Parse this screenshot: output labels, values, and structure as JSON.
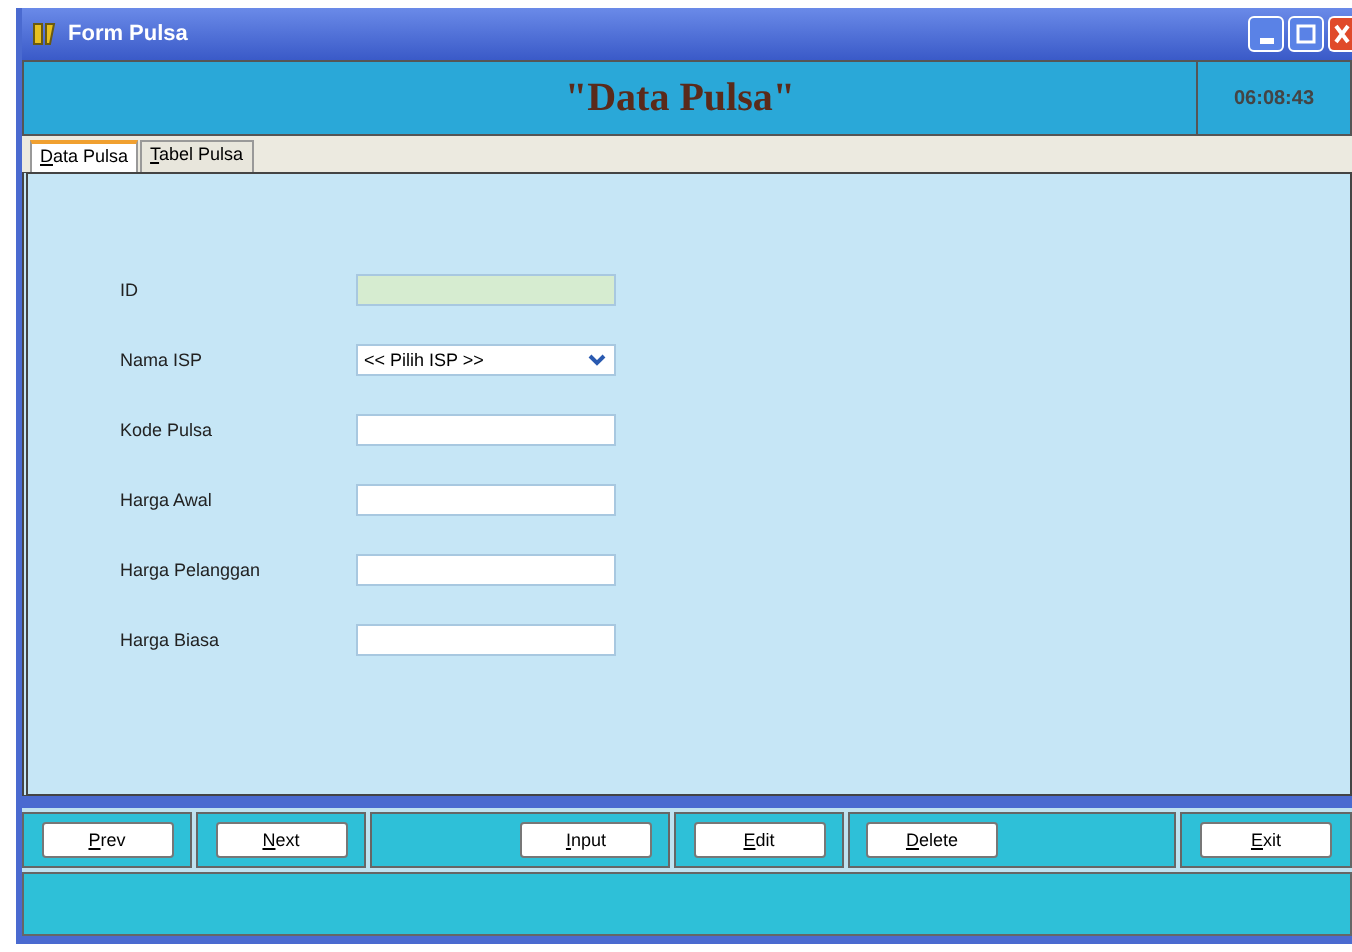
{
  "window": {
    "title": "Form Pulsa"
  },
  "header": {
    "title": "\"Data Pulsa\"",
    "clock": "06:08:43"
  },
  "tabs": [
    {
      "label": "Data Pulsa",
      "selected": true
    },
    {
      "label": "Tabel Pulsa",
      "selected": false
    }
  ],
  "fields": [
    {
      "label": "ID",
      "kind": "readonly"
    },
    {
      "label": "Nama ISP",
      "kind": "dropdown",
      "value": "<< Pilih ISP >>"
    },
    {
      "label": "Kode Pulsa",
      "kind": "text"
    },
    {
      "label": "Harga Awal",
      "kind": "text"
    },
    {
      "label": "Harga Pelanggan",
      "kind": "text"
    },
    {
      "label": "Harga Biasa",
      "kind": "text"
    }
  ],
  "button_groups": [
    [
      "Prev"
    ],
    [
      "Next"
    ],
    [
      "Input"
    ],
    [
      "Edit"
    ],
    [
      "Delete"
    ],
    [
      "Exit"
    ]
  ]
}
